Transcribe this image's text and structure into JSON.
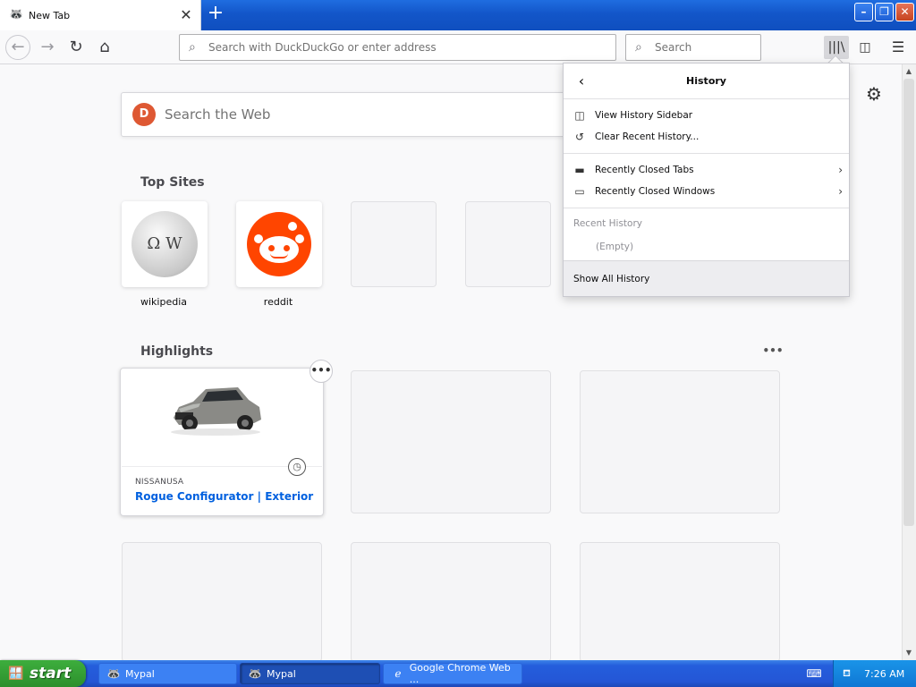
{
  "browser": {
    "tab": {
      "title": "New Tab",
      "favicon": "mypal-icon"
    },
    "urlbar": {
      "placeholder": "Search with DuckDuckGo or enter address"
    },
    "searchbar": {
      "placeholder": "Search"
    }
  },
  "newtab": {
    "websearch": {
      "placeholder": "Search the Web"
    },
    "topsites": {
      "title": "Top Sites",
      "sites": [
        {
          "label": "wikipedia"
        },
        {
          "label": "reddit"
        }
      ]
    },
    "highlights": {
      "title": "Highlights",
      "card": {
        "domain": "NISSANUSA",
        "title": "Rogue Configurator | Exterior | ..."
      }
    }
  },
  "history_panel": {
    "title": "History",
    "items": [
      {
        "label": "View History Sidebar",
        "icon": "sidebar-icon"
      },
      {
        "label": "Clear Recent History...",
        "icon": "history-icon"
      },
      {
        "label": "Recently Closed Tabs",
        "icon": "hat-icon"
      },
      {
        "label": "Recently Closed Windows",
        "icon": "window-icon"
      }
    ],
    "recent_label": "Recent History",
    "empty_label": "(Empty)",
    "show_all": "Show All History"
  },
  "taskbar": {
    "start": "start",
    "tasks": [
      {
        "label": "Mypal"
      },
      {
        "label": "Mypal"
      },
      {
        "label": "Google Chrome Web ..."
      }
    ],
    "clock": "7:26 AM"
  },
  "colors": {
    "accent": "#0060df",
    "titlebar": "#1356c9",
    "reddit": "#ff4500",
    "duckduckgo": "#de5833"
  }
}
